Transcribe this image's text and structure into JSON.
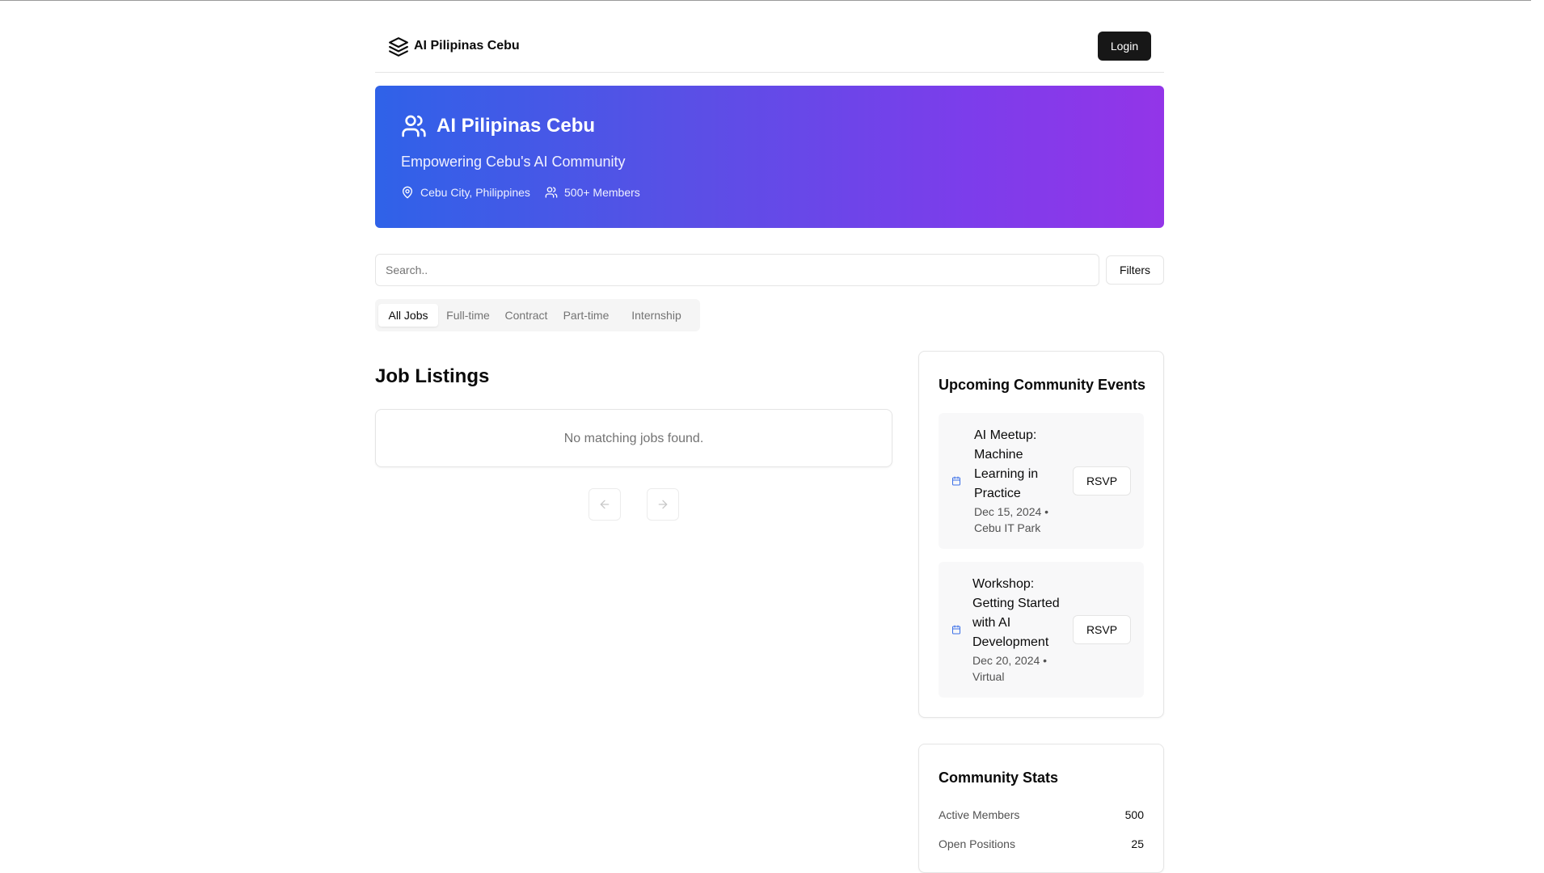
{
  "header": {
    "brand": "AI Pilipinas Cebu",
    "login_label": "Login"
  },
  "hero": {
    "title": "AI Pilipinas Cebu",
    "subtitle": "Empowering Cebu's AI Community",
    "location": "Cebu City, Philippines",
    "members": "500+ Members",
    "gradient_start": "#2f62e8",
    "gradient_end": "#9335e8"
  },
  "search": {
    "placeholder": "Search..",
    "filters_label": "Filters"
  },
  "tabs": [
    {
      "label": "All Jobs",
      "active": true
    },
    {
      "label": "Full-time",
      "active": false
    },
    {
      "label": "Contract",
      "active": false
    },
    {
      "label": "Part-time",
      "active": false
    },
    {
      "label": "Internship",
      "active": false
    }
  ],
  "jobs": {
    "title": "Job Listings",
    "empty_message": "No matching jobs found."
  },
  "events": {
    "title": "Upcoming Community Events",
    "items": [
      {
        "name": "AI Meetup: Machine Learning in Practice",
        "meta": "Dec 15, 2024 • Cebu IT Park",
        "rsvp_label": "RSVP",
        "icon": "calendar-icon"
      },
      {
        "name": "Workshop: Getting Started with AI Development",
        "meta": "Dec 20, 2024 • Virtual",
        "rsvp_label": "RSVP",
        "icon": "calendar-icon"
      }
    ]
  },
  "stats": {
    "title": "Community Stats",
    "rows": [
      {
        "label": "Active Members",
        "value": "500"
      },
      {
        "label": "Open Positions",
        "value": "25"
      }
    ]
  }
}
